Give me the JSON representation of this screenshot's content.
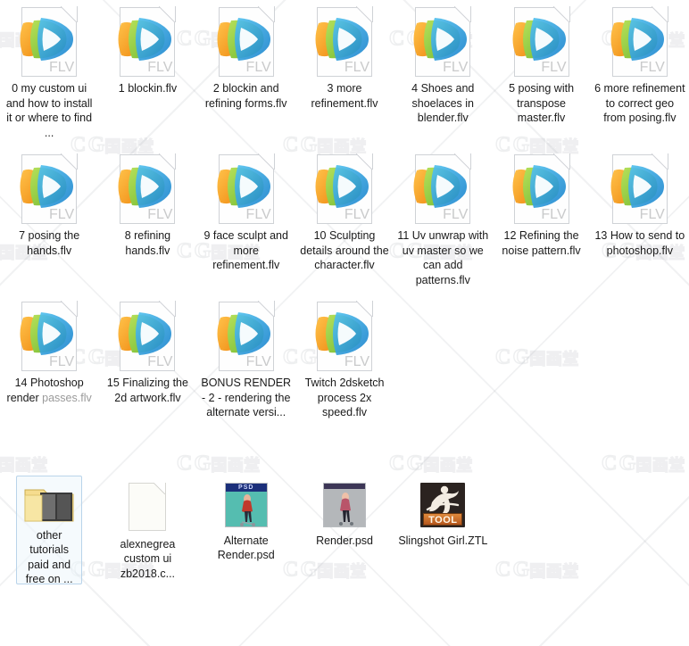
{
  "window": {
    "view": "icon-grid",
    "background_color": "#ffffff",
    "watermark_text_latin": "C G",
    "watermark_text_cjk": "国画堂"
  },
  "icon_types": {
    "flv": {
      "ext_label": "FLV",
      "icon_name": "flv-video-file-icon"
    },
    "folder": {
      "icon_name": "folder-icon"
    },
    "doc": {
      "icon_name": "generic-document-icon"
    },
    "psd": {
      "ext_label": "PSD",
      "icon_name": "photoshop-psd-thumbnail-icon"
    },
    "ztl": {
      "ext_label": "TOOL",
      "icon_name": "zbrush-ztl-tool-icon"
    }
  },
  "colors": {
    "flv_orange": "#f5a01e",
    "flv_green": "#8cc63f",
    "flv_blue": "#2b9fe0",
    "psd_band": "#1b2f7a",
    "ztl_bg": "#2b2320",
    "ztl_tool_band": "#c2661f",
    "selection_border": "#b9d4ea",
    "label_text": "#1a1a1a",
    "label_dim_text": "#9a9a9a"
  },
  "rows": [
    {
      "items": [
        {
          "type": "flv",
          "label": "0 my custom ui and how to install it or where to find ...",
          "selected": false
        },
        {
          "type": "flv",
          "label": "1 blockin.flv",
          "selected": false
        },
        {
          "type": "flv",
          "label": "2 blockin and refining forms.flv",
          "selected": false
        },
        {
          "type": "flv",
          "label": "3 more refinement.flv",
          "selected": false
        },
        {
          "type": "flv",
          "label": "4 Shoes and shoelaces in blender.flv",
          "selected": false
        },
        {
          "type": "flv",
          "label": "5 posing with transpose master.flv",
          "selected": false
        },
        {
          "type": "flv",
          "label": "6 more refinement to correct geo from posing.flv",
          "selected": false
        }
      ]
    },
    {
      "items": [
        {
          "type": "flv",
          "label": "7 posing the hands.flv",
          "selected": false
        },
        {
          "type": "flv",
          "label": "8 refining hands.flv",
          "selected": false
        },
        {
          "type": "flv",
          "label": "9 face sculpt and more refinement.flv",
          "selected": false
        },
        {
          "type": "flv",
          "label": "10 Sculpting details around the character.flv",
          "selected": false
        },
        {
          "type": "flv",
          "label": "11 Uv unwrap with uv master so we can add patterns.flv",
          "selected": false
        },
        {
          "type": "flv",
          "label": "12 Refining the noise pattern.flv",
          "selected": false
        },
        {
          "type": "flv",
          "label": "13 How to send to photoshop.flv",
          "selected": false
        }
      ]
    },
    {
      "items": [
        {
          "type": "flv",
          "label": "14 Photoshop render passes.flv",
          "label_dim_tail": "passes.flv",
          "selected": false
        },
        {
          "type": "flv",
          "label": "15 Finalizing the 2d artwork.flv",
          "selected": false
        },
        {
          "type": "flv",
          "label": "BONUS RENDER - 2 - rendering the alternate versi...",
          "selected": false
        },
        {
          "type": "flv",
          "label": "Twitch 2dsketch process 2x speed.flv",
          "selected": false
        }
      ]
    },
    {
      "items": [
        {
          "type": "folder",
          "label": "other tutorials paid and free on ...",
          "selected": true
        },
        {
          "type": "doc",
          "label": "alexnegrea custom ui zb2018.c...",
          "selected": false
        },
        {
          "type": "psd",
          "label": "Alternate Render.psd",
          "variant": "alternate",
          "selected": false
        },
        {
          "type": "psd",
          "label": "Render.psd",
          "variant": "render",
          "selected": false
        },
        {
          "type": "ztl",
          "label": "Slingshot Girl.ZTL",
          "selected": false
        }
      ]
    }
  ]
}
